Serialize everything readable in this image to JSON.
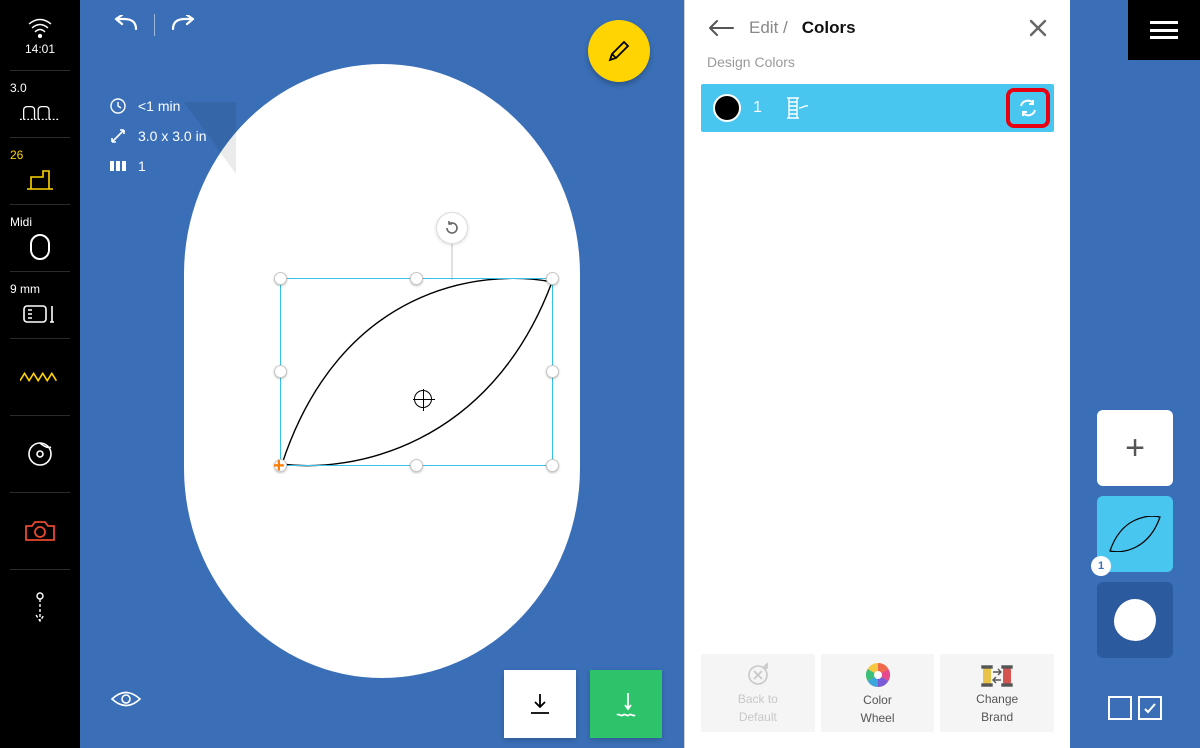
{
  "sidebar": {
    "clock": "14:01",
    "speed": "3.0",
    "stitch_count": "26",
    "hoop_size": "Midi",
    "needle": "9 mm"
  },
  "canvas": {
    "meta": {
      "time": "<1 min",
      "dimensions": "3.0 x 3.0 in",
      "colors": "1"
    }
  },
  "panel": {
    "breadcrumb_parent": "Edit /",
    "breadcrumb_current": "Colors",
    "subtitle": "Design Colors",
    "row1": {
      "number": "1"
    },
    "footer": {
      "back1": "Back to",
      "back2": "Default",
      "wheel1": "Color",
      "wheel2": "Wheel",
      "brand1": "Change",
      "brand2": "Brand"
    }
  },
  "rail": {
    "layer_badge": "1"
  }
}
